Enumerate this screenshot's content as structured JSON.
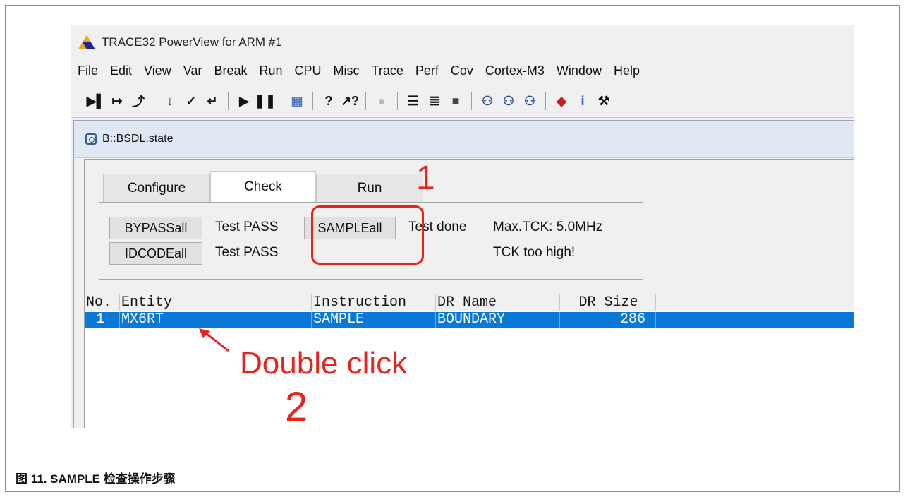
{
  "app": {
    "title": "TRACE32 PowerView for ARM #1"
  },
  "menu": [
    "File",
    "Edit",
    "View",
    "Var",
    "Break",
    "Run",
    "CPU",
    "Misc",
    "Trace",
    "Perf",
    "Cov",
    "Cortex-M3",
    "Window",
    "Help"
  ],
  "menu_underline_index": [
    0,
    0,
    0,
    -1,
    0,
    0,
    0,
    0,
    0,
    0,
    1,
    -1,
    0,
    0
  ],
  "toolbar": {
    "icons": [
      "step-into-icon",
      "step-over-icon",
      "step-return-icon",
      "down-arrow-icon",
      "check-return-icon",
      "return-icon",
      "go-icon",
      "break-icon",
      "memory-icon",
      "help-icon",
      "context-help-icon",
      "stop-icon",
      "list-icon",
      "register-icon",
      "chip-icon",
      "binoculars-icon",
      "binoculars-2-icon",
      "binoculars-3-icon",
      "cube-icon",
      "info-icon",
      "wrench-icon"
    ]
  },
  "window": {
    "title": "B::BSDL.state"
  },
  "tabs": [
    "Configure",
    "Check",
    "Run"
  ],
  "active_tab": "Check",
  "panel": {
    "bypass_button": "BYPASSall",
    "bypass_result": "Test PASS",
    "idcode_button": "IDCODEall",
    "idcode_result": "Test PASS",
    "sample_button": "SAMPLEall",
    "sample_result": "Test done",
    "max_tck": "Max.TCK: 5.0MHz",
    "tck_warning": "TCK too high!"
  },
  "table": {
    "headers": [
      "No.",
      "Entity",
      "Instruction",
      "DR Name",
      "DR Size"
    ],
    "rows": [
      {
        "no": "1",
        "entity": "MX6RT",
        "instruction": "SAMPLE",
        "dr_name": "BOUNDARY",
        "dr_size": "286"
      }
    ]
  },
  "annotations": {
    "step1": "1",
    "step2_label": "Double click",
    "step2": "2",
    "color": "#e8221c"
  },
  "caption": "图 11. SAMPLE 检查操作步骤"
}
